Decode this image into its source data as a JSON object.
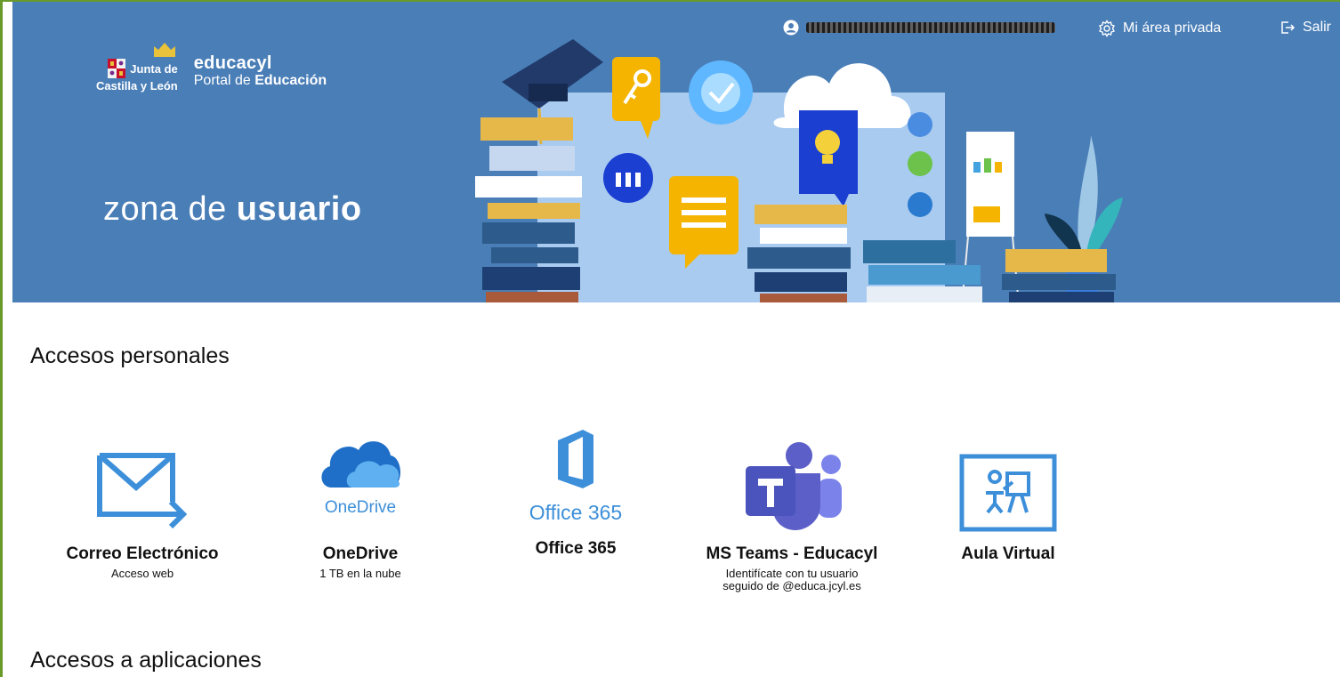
{
  "header": {
    "top_nav": {
      "area_privada": "Mi área privada",
      "salir": "Salir"
    },
    "logo": {
      "org_line1": "Junta de",
      "org_line2": "Castilla y León",
      "brand": "educacyl",
      "portal_prefix": "Portal de",
      "portal_strong": "Educación"
    },
    "zona": {
      "prefix": "zona de",
      "strong": "usuario"
    },
    "background_color": "#4a7eb7"
  },
  "personal": {
    "title": "Accesos personales",
    "tiles": [
      {
        "name": "Correo Electrónico",
        "desc": "Acceso web",
        "icon": "mail-forward-icon"
      },
      {
        "name": "OneDrive",
        "desc": "1 TB en la nube",
        "icon_label": "OneDrive",
        "icon": "onedrive-cloud-icon"
      },
      {
        "name": "Office 365",
        "desc": "",
        "icon_label": "Office 365",
        "icon": "office365-icon"
      },
      {
        "name": "MS Teams - Educacyl",
        "desc_line1": "Identifícate con tu usuario",
        "desc_line2": "seguido de @educa.jcyl.es",
        "icon": "teams-icon"
      },
      {
        "name": "Aula Virtual",
        "desc": "",
        "icon": "classroom-icon"
      }
    ]
  },
  "apps": {
    "title": "Accesos a aplicaciones"
  },
  "colors": {
    "brand_blue": "#4a7eb7",
    "icon_blue": "#3d8fd9",
    "teams_purple": "#5b5fc7"
  }
}
